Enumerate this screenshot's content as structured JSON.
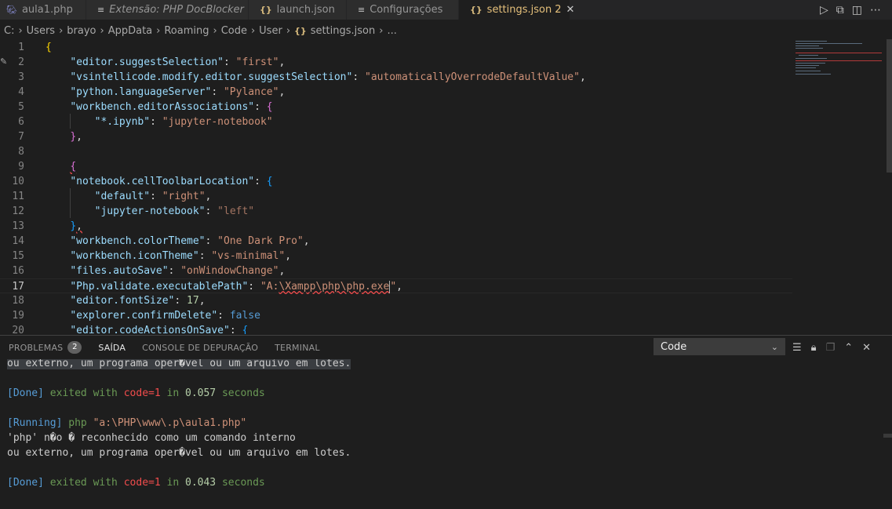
{
  "tabs": [
    {
      "icon": "php-icon",
      "label": "aula1.php",
      "italic": false,
      "active": false
    },
    {
      "icon": "extension-doc-icon",
      "label": "Extensão: PHP DocBlocker",
      "italic": true,
      "active": false
    },
    {
      "icon": "json-icon",
      "label": "launch.json",
      "italic": false,
      "active": false
    },
    {
      "icon": "settings-doc-icon",
      "label": "Configurações",
      "italic": false,
      "active": false
    },
    {
      "icon": "json-icon",
      "label": "settings.json",
      "badge": "2",
      "active": true
    }
  ],
  "tab_icons_text": {
    "json": "{}",
    "doc": "≡"
  },
  "tab_close": "✕",
  "breadcrumb": [
    "C:",
    "Users",
    "brayo",
    "AppData",
    "Roaming",
    "Code",
    "User",
    "settings.json",
    "..."
  ],
  "editor": {
    "current_line": "17",
    "lines": [
      {
        "n": "1"
      },
      {
        "n": "2"
      },
      {
        "n": "3"
      },
      {
        "n": "4"
      },
      {
        "n": "5"
      },
      {
        "n": "6"
      },
      {
        "n": "7"
      },
      {
        "n": "8"
      },
      {
        "n": "9"
      },
      {
        "n": "10"
      },
      {
        "n": "11"
      },
      {
        "n": "12"
      },
      {
        "n": "13"
      },
      {
        "n": "14"
      },
      {
        "n": "15"
      },
      {
        "n": "16"
      },
      {
        "n": "17"
      },
      {
        "n": "18"
      },
      {
        "n": "19"
      },
      {
        "n": "20"
      }
    ],
    "tokens": {
      "l2k": "\"editor.suggestSelection\"",
      "l2v": "\"first\"",
      "l3k": "\"vsintellicode.modify.editor.suggestSelection\"",
      "l3v": "\"automaticallyOverrodeDefaultValue\"",
      "l4k": "\"python.languageServer\"",
      "l4v": "\"Pylance\"",
      "l5k": "\"workbench.editorAssociations\"",
      "l6k": "\"*.ipynb\"",
      "l6v": "\"jupyter-notebook\"",
      "l10k": "\"notebook.cellToolbarLocation\"",
      "l11k": "\"default\"",
      "l11v": "\"right\"",
      "l12k": "\"jupyter-notebook\"",
      "l12v": "\"left\"",
      "l14k": "\"workbench.colorTheme\"",
      "l14v": "\"One Dark Pro\"",
      "l15k": "\"workbench.iconTheme\"",
      "l15v": "\"vs-minimal\"",
      "l16k": "\"files.autoSave\"",
      "l16v": "\"onWindowChange\"",
      "l17k": "\"Php.validate.executablePath\"",
      "l17v1": "\"A:",
      "l17v2": "\\Xampp\\php\\php.exe",
      "l17v3": "\"",
      "l18k": "\"editor.fontSize\"",
      "l18v": "17",
      "l19k": "\"explorer.confirmDelete\"",
      "l19v": "false",
      "l20k": "\"editor.codeActionsOnSave\""
    }
  },
  "panel": {
    "tabs": [
      {
        "label": "PROBLEMAS",
        "badge": "2",
        "active": false
      },
      {
        "label": "SAÍDA",
        "active": true
      },
      {
        "label": "CONSOLE DE DEPURAÇÃO",
        "active": false
      },
      {
        "label": "TERMINAL",
        "active": false
      }
    ],
    "channel_select": "Code",
    "output": {
      "l0": "ou externo, um programa oper�vel ou um arquivo em lotes.",
      "l2a": "[Done]",
      "l2b": " exited with ",
      "l2c": "code=1",
      "l2d": " in ",
      "l2e": "0.057",
      "l2f": " seconds",
      "l4a": "[Running]",
      "l4b": " php ",
      "l4c": "\"a:\\PHP\\www\\.p\\aula1.php\"",
      "l5": "'php' n�o � reconhecido como um comando interno",
      "l6": "ou externo, um programa oper�vel ou um arquivo em lotes.",
      "l8a": "[Done]",
      "l8b": " exited with ",
      "l8c": "code=1",
      "l8d": " in ",
      "l8e": "0.043",
      "l8f": " seconds"
    }
  },
  "colors": {
    "editor_bg": "#1e1e1e",
    "tab_active_fg": "#e5c07b",
    "key": "#9cdcfe",
    "string": "#ce9178",
    "number": "#b5cea8",
    "keyword": "#569cd6"
  }
}
